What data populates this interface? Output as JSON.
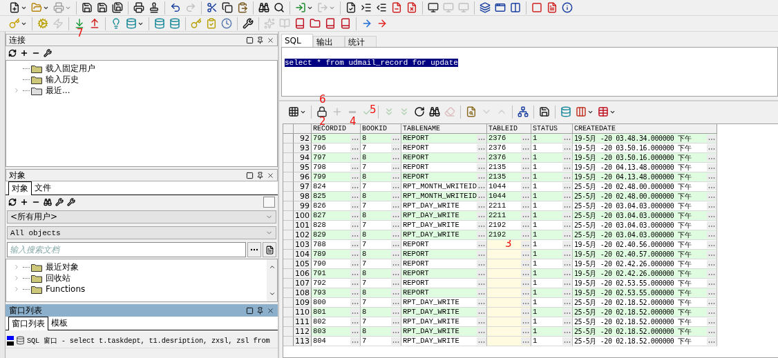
{
  "toolbar_rows": [
    [
      [
        {
          "disabled": false,
          "dropdown": true
        },
        {
          "disabled": false,
          "dropdown": true
        },
        {
          "disabled": true,
          "dropdown": true
        }
      ],
      [
        {
          "disabled": false
        },
        {
          "disabled": false
        },
        {
          "disabled": false
        }
      ],
      [
        {
          "disabled": false
        },
        {
          "disabled": false
        }
      ],
      [
        {
          "disabled": false
        },
        {
          "disabled": true
        }
      ],
      [
        {
          "disabled": false
        },
        {
          "disabled": false
        },
        {
          "disabled": false
        }
      ],
      [
        {
          "disabled": false
        },
        {
          "disabled": false
        }
      ],
      [
        {
          "disabled": false,
          "dropdown": true
        },
        {
          "disabled": true,
          "dropdown": true
        }
      ],
      [
        {
          "disabled": false
        },
        {
          "disabled": false
        },
        {
          "disabled": false
        },
        {
          "disabled": false
        },
        {
          "disabled": false
        }
      ],
      [
        {
          "disabled": false
        },
        {
          "disabled": true
        },
        {
          "disabled": true
        }
      ],
      [
        {
          "disabled": false
        },
        {
          "disabled": false
        },
        {
          "disabled": false
        }
      ],
      [
        {
          "disabled": false
        },
        {
          "disabled": false
        },
        {
          "disabled": false
        }
      ]
    ],
    [
      [
        {
          "disabled": false,
          "dropdown": true
        }
      ],
      [
        {
          "disabled": false
        },
        {
          "disabled": true
        }
      ],
      [
        {
          "disabled": false,
          "note_below": "7"
        },
        {
          "disabled": false
        }
      ],
      [
        {
          "disabled": false
        },
        {
          "disabled": false,
          "dropdown": true
        }
      ],
      [
        {
          "disabled": false
        },
        {
          "disabled": false
        }
      ],
      [
        {
          "disabled": false
        },
        {
          "disabled": false
        },
        {
          "disabled": false
        }
      ],
      [
        {
          "disabled": false
        }
      ],
      [
        {
          "disabled": true
        },
        {
          "disabled": true
        },
        {
          "disabled": false
        },
        {
          "disabled": false
        },
        {
          "disabled": false
        },
        {
          "disabled": false
        }
      ],
      [
        {
          "disabled": false
        },
        {
          "disabled": false
        }
      ]
    ]
  ],
  "connection_panel": {
    "title": "连接",
    "tree": [
      {
        "label": "载入固定用户"
      },
      {
        "label": "输入历史"
      },
      {
        "label": "最近...",
        "expanded": false
      }
    ]
  },
  "object_panel": {
    "title": "对象",
    "tabs": [
      {
        "label": "对象",
        "selected": true
      },
      {
        "label": "文件",
        "selected": false
      }
    ],
    "owner_select": "<所有用户>",
    "type_select": "All objects",
    "search": {
      "placeholder": "输入搜索文档"
    },
    "tree": [
      {
        "label": "最近对象",
        "expanded": false
      },
      {
        "label": "回收站",
        "expanded": false
      },
      {
        "label": "Functions",
        "expanded": false
      }
    ]
  },
  "window_list_panel": {
    "title": "窗口列表",
    "tabs": [
      {
        "label": "窗口列表",
        "selected": true
      },
      {
        "label": "模板",
        "selected": false
      }
    ],
    "items": [
      {
        "label": "SQL 窗口 - select t.taskdept, t1.desription, zxsl, zsl from"
      }
    ]
  },
  "editor_tabs": [
    {
      "label": "SQL",
      "selected": true
    },
    {
      "label": "输出",
      "selected": false
    },
    {
      "label": "统计",
      "selected": false
    }
  ],
  "editor": {
    "text": "select * from udmail_record for update",
    "selected": true
  },
  "result_toolbar": [
    [
      {
        "disabled": false,
        "dropdown": true
      }
    ],
    [
      {
        "disabled": false,
        "note_above": "6",
        "note_below": "2"
      },
      {
        "disabled": true
      },
      {
        "disabled": true,
        "note_below": "4"
      },
      {
        "disabled": true,
        "note_over": "5"
      }
    ],
    [
      {
        "disabled": true
      },
      {
        "disabled": true
      },
      {
        "disabled": false
      },
      {
        "disabled": false
      },
      {
        "disabled": true
      }
    ],
    [
      {
        "disabled": false
      },
      {
        "disabled": true
      },
      {
        "disabled": true
      }
    ],
    [
      {
        "disabled": false
      }
    ],
    [
      {
        "disabled": false
      }
    ],
    [
      {
        "disabled": false
      },
      {
        "disabled": false,
        "dropdown": true
      },
      {
        "disabled": false,
        "dropdown": true
      }
    ]
  ],
  "table": {
    "columns": [
      "RECORDID",
      "BOOKID",
      "TABLENAME",
      "TABLEID",
      "STATUS",
      "CREATEDATE"
    ],
    "rows": [
      {
        "number": "92",
        "cells": [
          "795",
          "8",
          "REPORT",
          "2376",
          "1",
          "19-5月 -20 03.48.34.000000 下午"
        ]
      },
      {
        "number": "93",
        "cells": [
          "796",
          "7",
          "REPORT",
          "2376",
          "1",
          "19-5月 -20 03.50.16.000000 下午"
        ]
      },
      {
        "number": "94",
        "cells": [
          "797",
          "8",
          "REPORT",
          "2376",
          "1",
          "19-5月 -20 03.50.16.000000 下午"
        ]
      },
      {
        "number": "95",
        "cells": [
          "798",
          "7",
          "REPORT",
          "2135",
          "1",
          "19-5月 -20 04.13.48.000000 下午"
        ]
      },
      {
        "number": "96",
        "cells": [
          "799",
          "8",
          "REPORT",
          "2135",
          "1",
          "19-5月 -20 04.13.48.000000 下午"
        ]
      },
      {
        "number": "97",
        "cells": [
          "824",
          "7",
          "RPT_MONTH_WRITEID",
          "1044",
          "1",
          "25-5月 -20 02.48.00.000000 下午"
        ]
      },
      {
        "number": "98",
        "cells": [
          "825",
          "8",
          "RPT_MONTH_WRITEID",
          "1044",
          "1",
          "25-5月 -20 02.48.00.000000 下午"
        ]
      },
      {
        "number": "99",
        "cells": [
          "826",
          "7",
          "RPT_DAY_WRITE",
          "2211",
          "1",
          "25-5月 -20 03.04.03.000000 下午"
        ]
      },
      {
        "number": "100",
        "cells": [
          "827",
          "8",
          "RPT_DAY_WRITE",
          "2211",
          "1",
          "25-5月 -20 03.04.03.000000 下午"
        ]
      },
      {
        "number": "101",
        "cells": [
          "828",
          "7",
          "RPT_DAY_WRITE",
          "2192",
          "1",
          "25-5月 -20 03.04.03.000000 下午"
        ]
      },
      {
        "number": "102",
        "cells": [
          "829",
          "8",
          "RPT_DAY_WRITE",
          "2192",
          "1",
          "25-5月 -20 03.04.03.000000 下午"
        ]
      },
      {
        "number": "103",
        "cells": [
          "788",
          "7",
          "REPORT",
          null,
          "1",
          "19-5月 -20 02.40.56.000000 下午"
        ],
        "annotation": "3"
      },
      {
        "number": "104",
        "cells": [
          "789",
          "8",
          "REPORT",
          null,
          "1",
          "19-5月 -20 02.40.57.000000 下午"
        ]
      },
      {
        "number": "105",
        "cells": [
          "790",
          "7",
          "REPORT",
          null,
          "1",
          "19-5月 -20 02.42.26.000000 下午"
        ]
      },
      {
        "number": "106",
        "cells": [
          "791",
          "8",
          "REPORT",
          null,
          "1",
          "19-5月 -20 02.42.26.000000 下午"
        ]
      },
      {
        "number": "107",
        "cells": [
          "792",
          "7",
          "REPORT",
          null,
          "1",
          "19-5月 -20 02.53.55.000000 下午"
        ]
      },
      {
        "number": "108",
        "cells": [
          "793",
          "8",
          "REPORT",
          null,
          "1",
          "19-5月 -20 02.53.55.000000 下午"
        ]
      },
      {
        "number": "109",
        "cells": [
          "800",
          "7",
          "RPT_DAY_WRITE",
          null,
          "1",
          "25-5月 -20 02.18.52.000000 下午"
        ]
      },
      {
        "number": "110",
        "cells": [
          "801",
          "8",
          "RPT_DAY_WRITE",
          null,
          "1",
          "25-5月 -20 02.18.52.000000 下午"
        ]
      },
      {
        "number": "111",
        "cells": [
          "802",
          "7",
          "RPT_DAY_WRITE",
          null,
          "1",
          "25-5月 -20 02.18.52.000000 下午"
        ]
      },
      {
        "number": "112",
        "cells": [
          "803",
          "8",
          "RPT_DAY_WRITE",
          null,
          "1",
          "25-5月 -20 02.18.52.000000 下午"
        ]
      },
      {
        "number": "113",
        "cells": [
          "804",
          "7",
          "RPT_DAY_WRITE",
          null,
          "1",
          "25-5月 -20 02.18.52.000000 下午"
        ]
      }
    ]
  }
}
